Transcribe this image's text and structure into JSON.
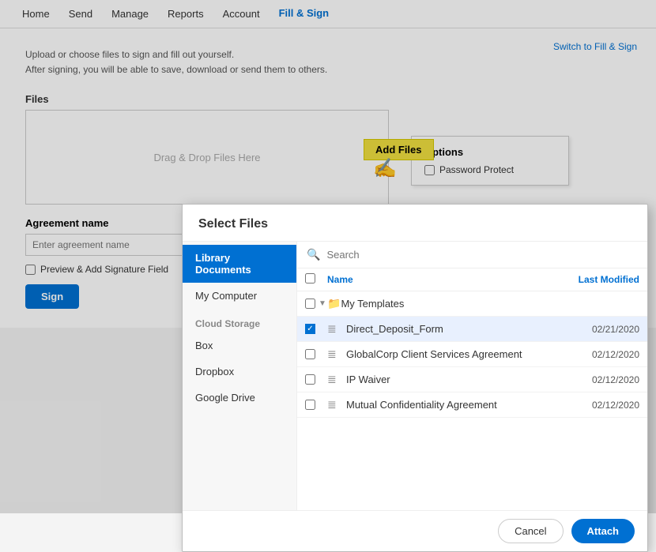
{
  "nav": {
    "items": [
      {
        "label": "Home",
        "active": false
      },
      {
        "label": "Send",
        "active": false
      },
      {
        "label": "Manage",
        "active": false
      },
      {
        "label": "Reports",
        "active": false
      },
      {
        "label": "Account",
        "active": false
      },
      {
        "label": "Fill & Sign",
        "active": true
      }
    ]
  },
  "main": {
    "switch_link": "Switch to Fill & Sign",
    "description_line1": "Upload or choose files to sign and fill out yourself.",
    "description_line2": "After signing, you will be able to save, download or send them to others.",
    "files_label": "Files",
    "add_files_btn": "Add Files",
    "drag_drop_text": "Drag & Drop Files Here",
    "options": {
      "title": "Options",
      "password_protect": "Password Protect"
    },
    "agreement": {
      "label": "Agreement name",
      "placeholder": "Enter agreement name"
    },
    "preview_label": "Preview & Add Signature Field",
    "sign_btn": "Sign"
  },
  "modal": {
    "title": "Select Files",
    "search_placeholder": "Search",
    "sidebar": {
      "items": [
        {
          "label": "Library Documents",
          "active": true
        },
        {
          "label": "My Computer",
          "active": false
        }
      ],
      "cloud_section": "Cloud Storage",
      "cloud_items": [
        {
          "label": "Box"
        },
        {
          "label": "Dropbox"
        },
        {
          "label": "Google Drive"
        }
      ]
    },
    "table": {
      "col_name": "Name",
      "col_modified": "Last Modified",
      "folder": "My Templates",
      "files": [
        {
          "name": "Direct_Deposit_Form",
          "date": "02/21/2020",
          "checked": true
        },
        {
          "name": "GlobalCorp Client Services Agreement",
          "date": "02/12/2020",
          "checked": false
        },
        {
          "name": "IP Waiver",
          "date": "02/12/2020",
          "checked": false
        },
        {
          "name": "Mutual Confidentiality Agreement",
          "date": "02/12/2020",
          "checked": false
        }
      ]
    },
    "footer": {
      "cancel": "Cancel",
      "attach": "Attach"
    }
  }
}
